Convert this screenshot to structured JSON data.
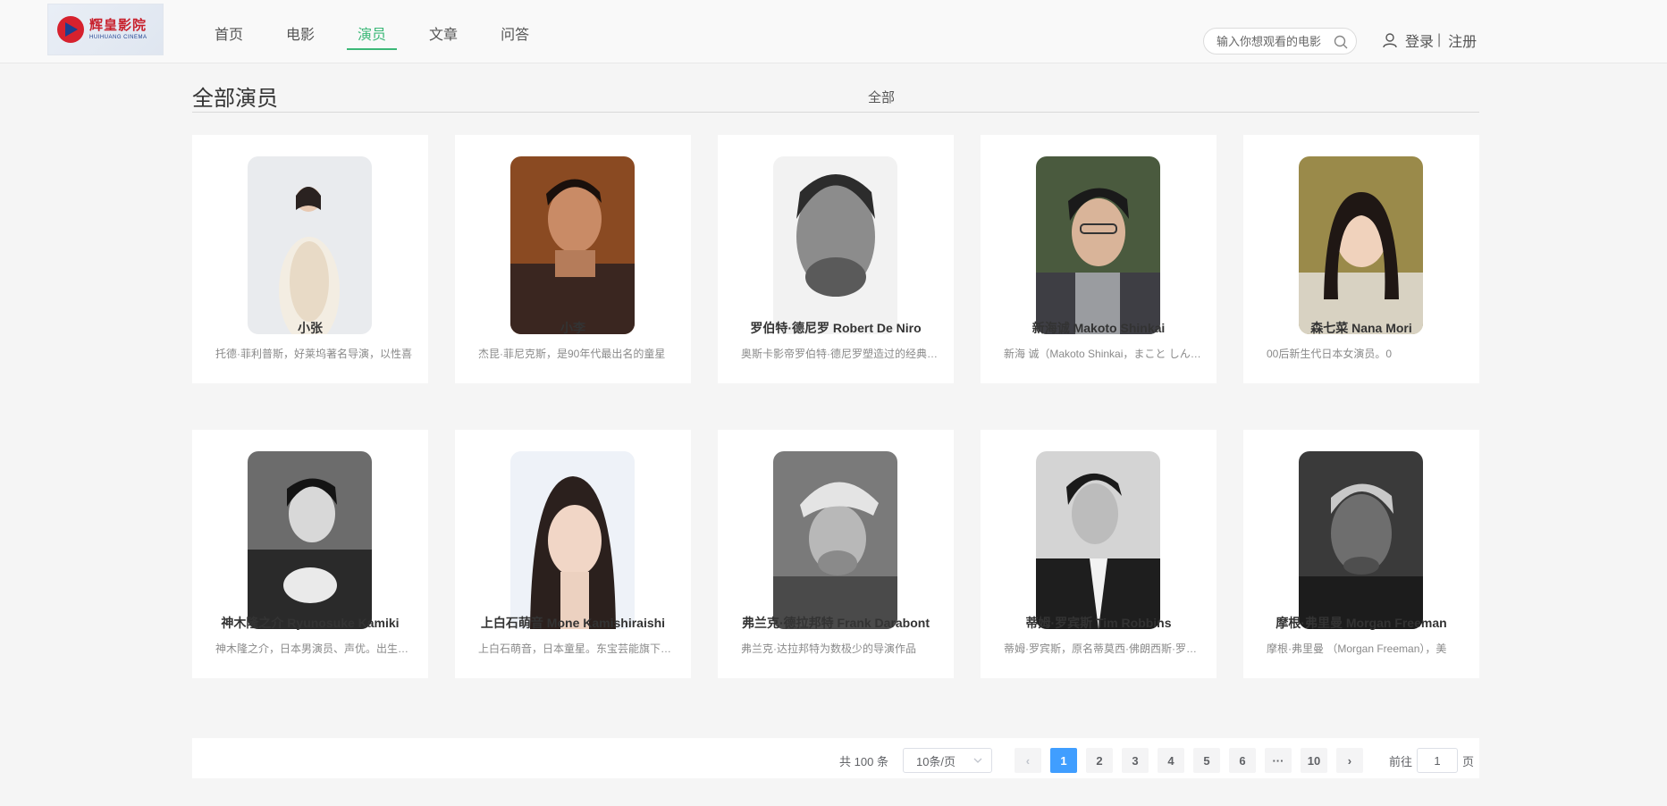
{
  "header": {
    "logo_cn": "辉皇影院",
    "logo_en": "HUIHUANG CINEMA",
    "nav": [
      "首页",
      "电影",
      "演员",
      "文章",
      "问答"
    ],
    "active_nav": "演员",
    "search_placeholder": "输入你想观看的电影",
    "login": "登录",
    "separator": "|",
    "register": "注册"
  },
  "section": {
    "title": "全部演员",
    "filter": "全部"
  },
  "actors": [
    {
      "name": "小张",
      "desc": "托德·菲利普斯，好莱坞著名导演，以性喜"
    },
    {
      "name": "小李",
      "desc": "杰昆·菲尼克斯，是90年代最出名的童星"
    },
    {
      "name": "罗伯特·德尼罗 Robert De Niro",
      "desc": "奥斯卡影帝罗伯特·德尼罗塑造过的经典角色"
    },
    {
      "name": "新海诚 Makoto Shinkai",
      "desc": "新海 诚（Makoto Shinkai，まこと しんかい）"
    },
    {
      "name": "森七菜 Nana Mori",
      "desc": "00后新生代日本女演员。0"
    },
    {
      "name": "神木隆之介 Ryunosuke Kamiki",
      "desc": "神木隆之介，日本男演员、声优。出生于埼玉县"
    },
    {
      "name": "上白石萌音 Mone Kamishiraishi",
      "desc": "上白石萌音，日本童星。东宝芸能旗下演员"
    },
    {
      "name": "弗兰克·德拉邦特 Frank Darabont",
      "desc": "弗兰克·达拉邦特为数极少的导演作品"
    },
    {
      "name": "蒂姆·罗宾斯 Tim Robbins",
      "desc": "蒂姆·罗宾斯，原名蒂莫西·佛朗西斯·罗宾斯"
    },
    {
      "name": "摩根·弗里曼 Morgan Freeman",
      "desc": "摩根·弗里曼 （Morgan Freeman），美"
    }
  ],
  "pagination": {
    "total": "共 100 条",
    "page_size": "10条/页",
    "prev": "‹",
    "next": "›",
    "pages": [
      "1",
      "2",
      "3",
      "4",
      "5",
      "6",
      "···",
      "10"
    ],
    "current": "1",
    "goto_prefix": "前往",
    "goto_value": "1",
    "goto_suffix": "页"
  },
  "colors": {
    "accent_green": "#3cb878",
    "pager_active": "#409eff"
  }
}
